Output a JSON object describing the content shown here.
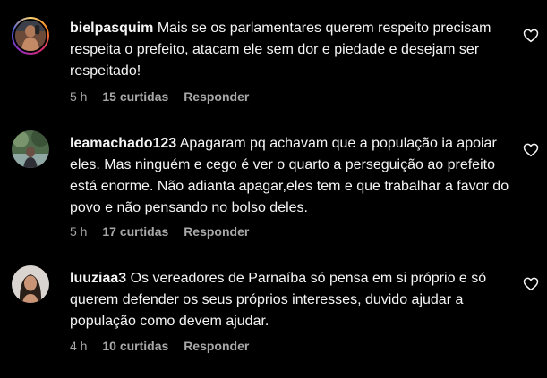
{
  "comments": [
    {
      "username": "bielpasquim",
      "text": "Mais se os parlamentares querem respeito precisam respeita o prefeito, atacam ele sem dor e piedade e desejam ser respeitado!",
      "time": "5 h",
      "likes": "15 curtidas",
      "reply": "Responder",
      "avatar_icon": "profile-photo-shirtless-man",
      "heart_icon": "heart-outline-icon"
    },
    {
      "username": "leamachado123",
      "text": "Apagaram pq achavam que a população ia apoiar eles. Mas ninguém e cego é ver o quarto a perseguição ao prefeito está enorme. Não adianta apagar,eles tem e que trabalhar a favor do povo e não pensando no bolso deles.",
      "time": "5 h",
      "likes": "17 curtidas",
      "reply": "Responder",
      "avatar_icon": "profile-photo-outdoor-person",
      "heart_icon": "heart-outline-icon"
    },
    {
      "username": "luuziaa3",
      "text": "Os vereadores de Parnaíba só pensa em si próprio e só querem defender os seus próprios interesses, duvido ajudar a população como devem ajudar.",
      "time": "4 h",
      "likes": "10 curtidas",
      "reply": "Responder",
      "avatar_icon": "profile-photo-woman-dark-hair",
      "heart_icon": "heart-outline-icon"
    }
  ],
  "colors": {
    "background": "#000000",
    "text": "#f5f5f5",
    "secondary_text": "#a8a8a8",
    "story_ring": [
      "#feda75",
      "#fa7e1e",
      "#d62976",
      "#962fbf",
      "#4f5bd5"
    ]
  }
}
